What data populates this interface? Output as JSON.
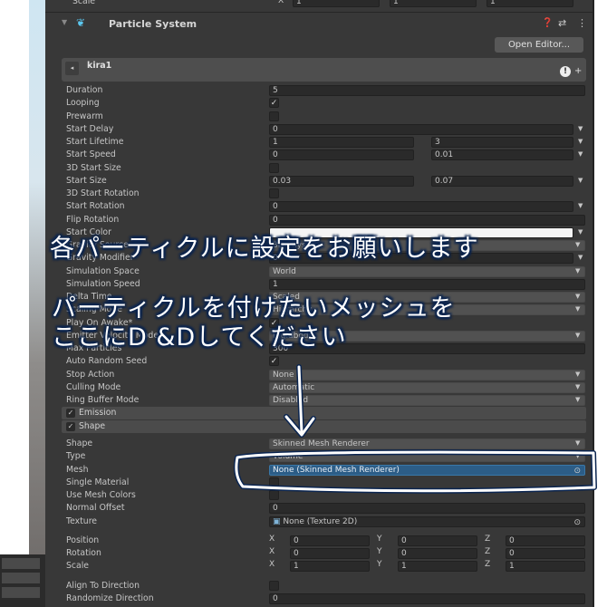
{
  "top_transform": {
    "label": "Scale",
    "x": "1",
    "y": "1",
    "z": "1"
  },
  "component": {
    "title": "Particle System",
    "open_editor": "Open Editor...",
    "system_name": "kira1"
  },
  "main_rows": [
    {
      "label": "Duration",
      "type": "field",
      "value": "5"
    },
    {
      "label": "Looping",
      "type": "check",
      "checked": true
    },
    {
      "label": "Prewarm",
      "type": "check",
      "checked": false
    },
    {
      "label": "Start Delay",
      "type": "field",
      "value": "0",
      "arrow": true
    },
    {
      "label": "Start Lifetime",
      "type": "two",
      "value": "1",
      "value2": "3"
    },
    {
      "label": "Start Speed",
      "type": "two",
      "value": "0",
      "value2": "0.01"
    },
    {
      "label": "3D Start Size",
      "type": "check",
      "checked": false
    },
    {
      "label": "Start Size",
      "type": "two",
      "value": "0.03",
      "value2": "0.07"
    },
    {
      "label": "3D Start Rotation",
      "type": "check",
      "checked": false
    },
    {
      "label": "Start Rotation",
      "type": "field",
      "value": "0",
      "arrow": true
    },
    {
      "label": "Flip Rotation",
      "type": "field",
      "value": "0"
    },
    {
      "label": "Start Color",
      "type": "color",
      "arrow": true
    },
    {
      "label": "Gravity Source",
      "type": "dropdown",
      "value": "3D Physics"
    },
    {
      "label": "Gravity Modifier",
      "type": "field",
      "value": "0",
      "arrow": true
    },
    {
      "label": "Simulation Space",
      "type": "dropdown",
      "value": "World"
    },
    {
      "label": "Simulation Speed",
      "type": "field",
      "value": "1"
    },
    {
      "label": "Delta Time",
      "type": "dropdown",
      "value": "Scaled"
    },
    {
      "label": "Scaling Mode",
      "type": "dropdown",
      "value": "Hierarchy"
    },
    {
      "label": "Play On Awake*",
      "type": "check",
      "checked": true
    },
    {
      "label": "Emitter Velocity Mode",
      "type": "dropdown",
      "value": "Rigidbody"
    },
    {
      "label": "Max Particles",
      "type": "field",
      "value": "300"
    },
    {
      "label": "Auto Random Seed",
      "type": "check",
      "checked": true
    },
    {
      "label": "Stop Action",
      "type": "dropdown",
      "value": "None"
    },
    {
      "label": "Culling Mode",
      "type": "dropdown",
      "value": "Automatic"
    },
    {
      "label": "Ring Buffer Mode",
      "type": "dropdown",
      "value": "Disabled"
    }
  ],
  "modules": [
    {
      "label": "Emission",
      "checked": true
    },
    {
      "label": "Shape",
      "checked": true
    }
  ],
  "shape_rows": [
    {
      "label": "Shape",
      "type": "dropdown",
      "value": "Skinned Mesh Renderer"
    },
    {
      "label": "Type",
      "type": "dropdown",
      "value": "Volume"
    },
    {
      "label": "Mesh",
      "type": "object",
      "value": "None (Skinned Mesh Renderer)",
      "selected": true
    },
    {
      "label": "Single Material",
      "type": "check",
      "checked": false
    },
    {
      "label": "Use Mesh Colors",
      "type": "check",
      "checked": false
    },
    {
      "label": "Normal Offset",
      "type": "field",
      "value": "0"
    },
    {
      "label": "Texture",
      "type": "object",
      "value": "None (Texture 2D)",
      "icon": true
    },
    {
      "type": "gap"
    },
    {
      "label": "Position",
      "type": "vec3",
      "x": "0",
      "y": "0",
      "z": "0"
    },
    {
      "label": "Rotation",
      "type": "vec3",
      "x": "0",
      "y": "0",
      "z": "0"
    },
    {
      "label": "Scale",
      "type": "vec3",
      "x": "1",
      "y": "1",
      "z": "1"
    },
    {
      "type": "gap"
    },
    {
      "label": "Align To Direction",
      "type": "check",
      "checked": false
    },
    {
      "label": "Randomize Direction",
      "type": "field",
      "value": "0"
    }
  ],
  "annotations": {
    "line1": "各パーティクルに設定をお願いします",
    "line2": "パーティクルを付けたいメッシュを",
    "line3": "ここにD &Dしてください"
  },
  "colors": {
    "panel": "#383838",
    "selected_field": "#2c5d87",
    "annotation_outline": "#0b2550"
  }
}
